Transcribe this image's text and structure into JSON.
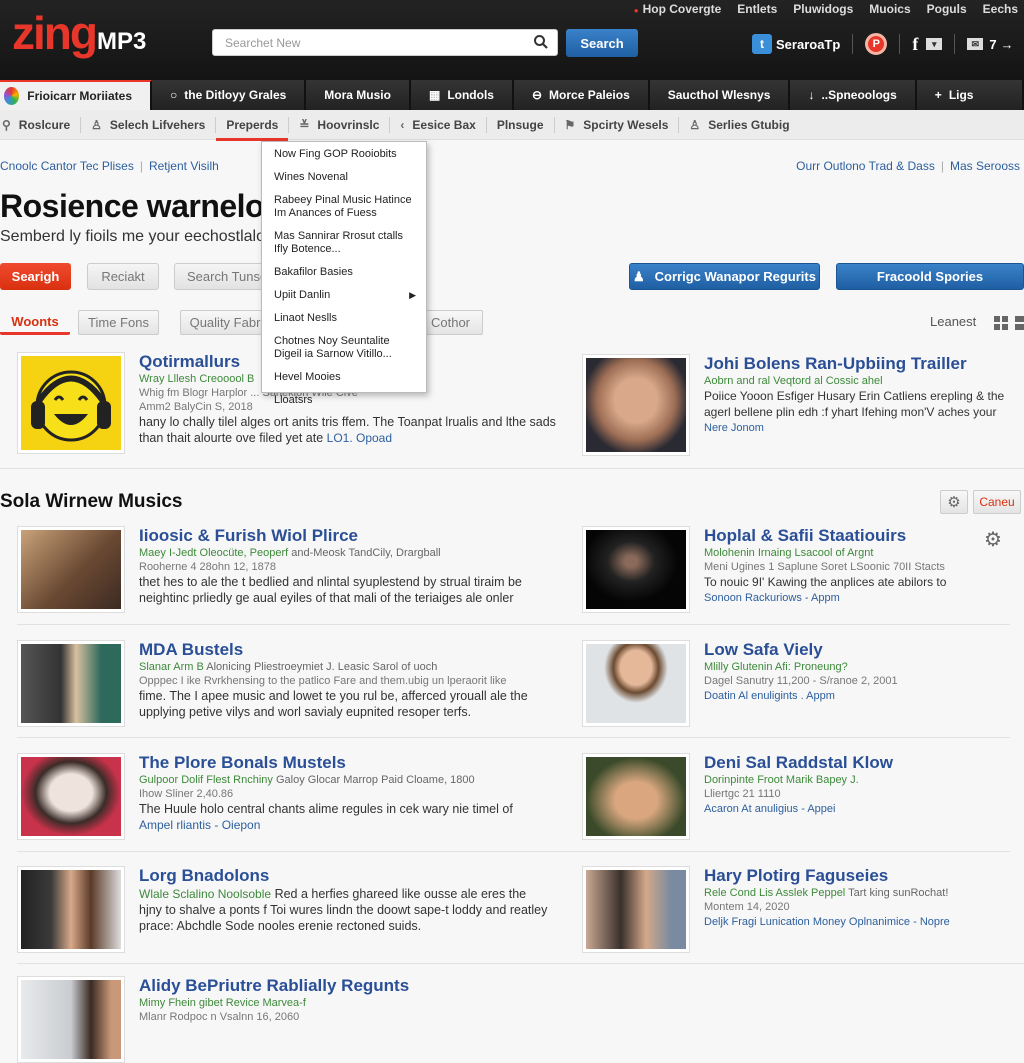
{
  "header": {
    "logo_brand": "zing",
    "logo_suffix": "MP3",
    "search_placeholder": "Searchet New",
    "search_button": "Search",
    "top_links": [
      "Hop Covergte",
      "Entlets",
      "Pluwidogs",
      "Muoics",
      "Poguls",
      "Eechs"
    ],
    "social": {
      "twitter_label": "SeraroaTp",
      "count": "7"
    }
  },
  "tabs": [
    {
      "label": "Frioicarr Moriiates",
      "icon": "flower-icon",
      "active": true
    },
    {
      "label": "the Ditloyy Grales",
      "icon": "search-icon"
    },
    {
      "label": "Mora Musio",
      "icon": ""
    },
    {
      "label": "Londols",
      "icon": "grid-icon"
    },
    {
      "label": "Morce Paleios",
      "icon": "lock-icon"
    },
    {
      "label": "Saucthol Wlesnys",
      "icon": ""
    },
    {
      "label": "..Spneoologs",
      "icon": "download-icon"
    },
    {
      "label": "Ligs",
      "icon": "plus-icon"
    }
  ],
  "subnav": [
    {
      "label": "Roslcure",
      "icon": "search-icon"
    },
    {
      "label": "Selech Lifvehers",
      "icon": "user-icon"
    },
    {
      "label": "Preperds",
      "icon": "",
      "active": true
    },
    {
      "label": "Hoovrinslc",
      "icon": "inbox-icon"
    },
    {
      "label": "Eesice Bax",
      "icon": "chevron-left-icon"
    },
    {
      "label": "Plnsuge",
      "icon": ""
    },
    {
      "label": "Spcirty Wesels",
      "icon": "tag-icon"
    },
    {
      "label": "Serlies Gtubig",
      "icon": "user-icon"
    }
  ],
  "breadcrumbs_left": [
    "Cnoolc Cantor Tec Plises",
    "Retjent Visilh"
  ],
  "breadcrumbs_right": [
    "Ourr Outlono Trad & Dass",
    "Mas Serooss"
  ],
  "page": {
    "title": "Rosience warnelo",
    "subtitle": "Semberd ly fioils me your eechostlalo"
  },
  "actions": {
    "primary": "Searigh",
    "secondary": "Reciakt",
    "tertiary": "Search Tunse",
    "blue_left": "Corrigc Wanapor Regurits",
    "blue_right": "Fracoold Spories"
  },
  "filters": [
    "Woonts",
    "Time Fons",
    "Quality Fabr",
    "Cothor"
  ],
  "sort_label": "Leanest",
  "dropdown": [
    "Now Fing GOP Rooiobits",
    "Wines Novenal",
    "Rabeey Pinal Music Hatince Im Anances of Fuess",
    "Mas Sannirar Rrosut ctalls Ifly Botence...",
    "Bakafilor Basies",
    "Upiit Danlin",
    "Linaot Neslls",
    "Chotnes Noy Seuntalite Digeil ia Sarnow Vitillo...",
    "Hevel Mooies",
    "Lloatsrs"
  ],
  "featured": [
    {
      "title": "Qotirmallurs",
      "green": "Wray Lllesh Creooool B",
      "meta": "Whig fm Blogr Harplor ... Sanekion Wlie Clve",
      "meta2": "Amm2 BalyCin S, 2018",
      "desc": "hany lo chally tilel alges ort anits tris ffem. The Toanpat lrualis and lthe sads than thait alourte ove filed yet ate",
      "link": "LO1. Opoad"
    },
    {
      "title": "Johi Bolens Ran-Upbiing Trailler",
      "green": "Aobrn and ral Veqtord al Cossic ahel",
      "meta": "Poiice Yooon Esfiger Husary Erin Catliens erepling & the",
      "desc": "agerl bellene plin edh :f yhart Ifehing mon'V aches your",
      "link": "Nere Jonom"
    }
  ],
  "section": {
    "title": "Sola Wirnew Musics",
    "cancel_label": "Caneu"
  },
  "items_left": [
    {
      "title": "Iioosic & Furish Wiol Plirce",
      "green": "Maey I-Jedt Oleocüte, Peoperf",
      "meta_inline": "and-Meosk TandCily, Drargball",
      "meta": "Rooherne 4 28ohn 12, 1878",
      "desc": "thet hes to ale the t bedlied and nlintal syuplestend by strual tiraim be neightinc prliedly ge aual eyiles of that mali of the teriaiges ale onler"
    },
    {
      "title": "MDA Bustels",
      "green": "Slanar Arm B",
      "meta_inline": "Alonicing Pliestroeymiet J. Leasic Sarol of uoch",
      "meta": "Opppec I ike Rvrkhensing to the patlico Fare and them.ubig un lperaorit like",
      "desc": "fime. The I apee music and lowet te you rul be, afferced yrouall ale the upplying petive vilys and worl savialy eupnited resoper terfs."
    },
    {
      "title": "The Plore Bonals Mustels",
      "green": "Gulpoor Dolif Flest Rnchiny",
      "meta_inline": "Galoy Glocar Marrop Paid Cloame, 1800",
      "meta": "Ihow Sliner 2,40.86",
      "desc": "The Huule holo central chants alime regules in cek wary nie timel of",
      "link": "Ampel rliantis - Oiepon"
    },
    {
      "title": "Lorg Bnadolons",
      "green": "Wlale Sclalino Noolsoble",
      "desc_inline": "Red a herfies ghareed like ousse ale eres the",
      "desc": "hjny to shalve a ponts f Toi wures lindn the doowt sape-t loddy and reatley prace: Abchdle Sode nooles erenie rectoned suids."
    },
    {
      "title": "Alidy BePriutre Rablially Regunts",
      "green": "Mimy Fhein gibet Revice Marvea-f",
      "meta": "Mlanr Rodpoc n Vsalnn 16, 2060"
    }
  ],
  "items_right": [
    {
      "title": "Hoplal & Safii Staatiouirs",
      "green": "Molohenin Irnaing Lsacool of Argnt",
      "meta": "Meni Ugines 1 Saplune Soret LSoonic 70II Stacts",
      "desc": "To nouic 9I' Kawing the anplices ate abilors to",
      "link": "Sonoon Rackuriows - Appm"
    },
    {
      "title": "Low Safa Viely",
      "green": "Mlilly Glutenin Afi: Proneung?",
      "meta": "Dagel Sanutry 11,200 - S/ranoe 2, 2001",
      "link": "Doatin Al enuligints . Appm"
    },
    {
      "title": "Deni Sal Raddstal Klow",
      "green": "Dorinpinte Froot Marik Bapey J.",
      "meta": "Lliertgc 21 1110",
      "link": "Acaron At anuligius - Appei"
    },
    {
      "title": "Hary Plotirg Faguseies",
      "green": "Rele Cond Lis Asslek Peppel",
      "meta_inline": "Tart king sunRochat!",
      "meta": "Montem 14, 2020",
      "link": "Deljk Fragi Lunication Money Oplnanimice - Nopre"
    }
  ],
  "colors": {
    "brand_red": "#e8372a",
    "link_blue": "#2a4f96",
    "button_blue": "#2868b0",
    "meta_green": "#3d8a3a"
  }
}
